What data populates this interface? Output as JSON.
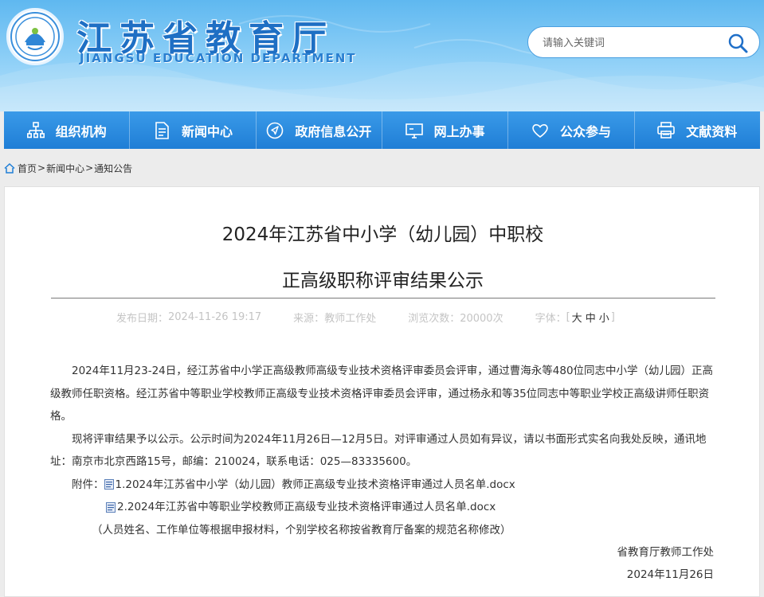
{
  "header": {
    "site_title": "江苏省教育厅",
    "site_subtitle": "JIANGSU EDUCATION DEPARTMENT",
    "search_placeholder": "请输入关键词"
  },
  "nav": {
    "items": [
      {
        "label": "组织机构",
        "icon": "org-chart-icon"
      },
      {
        "label": "新闻中心",
        "icon": "document-icon"
      },
      {
        "label": "政府信息公开",
        "icon": "send-icon"
      },
      {
        "label": "网上办事",
        "icon": "monitor-icon"
      },
      {
        "label": "公众参与",
        "icon": "heart-icon"
      },
      {
        "label": "文献资料",
        "icon": "printer-icon"
      }
    ]
  },
  "breadcrumb": {
    "home": "首页",
    "news": "新闻中心",
    "current": "通知公告",
    "separator": ">"
  },
  "article": {
    "title_line1": "2024年江苏省中小学（幼儿园）中职校",
    "title_line2": "正高级职称评审结果公示",
    "meta": {
      "date_label": "发布日期：",
      "date": "2024-11-26 19:17",
      "source_label": "来源：",
      "source": "教师工作处",
      "views_label": "浏览次数：",
      "views": "20000次",
      "font_label": "字体：",
      "bracket_open": "[",
      "bracket_close": "]",
      "font_large": "大",
      "font_medium": "中",
      "font_small": "小"
    },
    "paragraph1": "2024年11月23-24日，经江苏省中小学正高级教师高级专业技术资格评审委员会评审，通过曹海永等480位同志中小学（幼儿园）正高级教师任职资格。经江苏省中等职业学校教师正高级专业技术资格评审委员会评审，通过杨永和等35位同志中等职业学校正高级讲师任职资格。",
    "paragraph2": "现将评审结果予以公示。公示时间为2024年11月26日—12月5日。对评审通过人员如有异议，请以书面形式实名向我处反映，通讯地址：南京市北京西路15号，邮编：210024，联系电话：025—83335600。",
    "attachments_label": "附件：",
    "attachments": [
      "1.2024年江苏省中小学（幼儿园）教师正高级专业技术资格评审通过人员名单.docx",
      "2.2024年江苏省中等职业学校教师正高级专业技术资格评审通过人员名单.docx"
    ],
    "note": "（人员姓名、工作单位等根据申报材料，个别学校名称按省教育厅备案的规范名称修改）",
    "signature": "省教育厅教师工作处",
    "sign_date": "2024年11月26日"
  },
  "colors": {
    "nav_bg": "#1f7ed6",
    "header_bg": "#8fd0f7",
    "title_blue": "#1e6fc4"
  }
}
